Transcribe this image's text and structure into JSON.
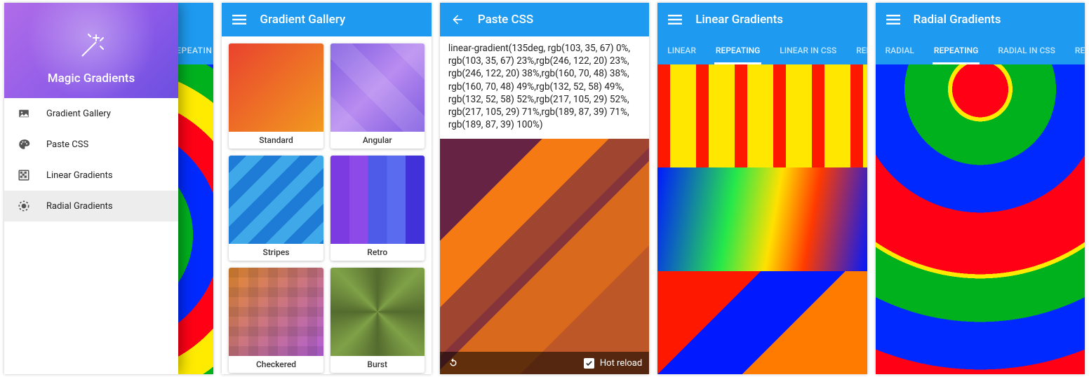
{
  "drawer": {
    "title": "Magic Gradients",
    "peek_tab": "REPEATIN",
    "items": [
      {
        "label": "Gradient Gallery",
        "icon": "image-icon"
      },
      {
        "label": "Paste CSS",
        "icon": "palette-icon"
      },
      {
        "label": "Linear Gradients",
        "icon": "grid-icon"
      },
      {
        "label": "Radial Gradients",
        "icon": "target-icon"
      }
    ],
    "selected_index": 3
  },
  "gallery": {
    "title": "Gradient Gallery",
    "cards": [
      {
        "label": "Standard"
      },
      {
        "label": "Angular"
      },
      {
        "label": "Stripes"
      },
      {
        "label": "Retro"
      },
      {
        "label": "Checkered"
      },
      {
        "label": "Burst"
      }
    ]
  },
  "paste": {
    "title": "Paste CSS",
    "css": "linear-gradient(135deg, rgb(103, 35, 67) 0%, rgb(103, 35, 67) 23%,rgb(246, 122, 20) 23%, rgb(246, 122, 20) 38%,rgb(160, 70, 48) 38%, rgb(160, 70, 48) 49%,rgb(132, 52, 58) 49%, rgb(132, 52, 58) 52%,rgb(217, 105, 29) 52%, rgb(217, 105, 29) 71%,rgb(189, 87, 39) 71%, rgb(189, 87, 39) 100%)",
    "hot_reload_label": "Hot reload",
    "hot_reload_checked": true
  },
  "linear": {
    "title": "Linear Gradients",
    "tabs": [
      "LINEAR",
      "REPEATING",
      "LINEAR IN CSS",
      "REPEATI"
    ],
    "active_tab": 1
  },
  "radial": {
    "title": "Radial Gradients",
    "tabs": [
      "RADIAL",
      "REPEATING",
      "RADIAL IN CSS",
      "REPEATI"
    ],
    "active_tab": 1
  }
}
